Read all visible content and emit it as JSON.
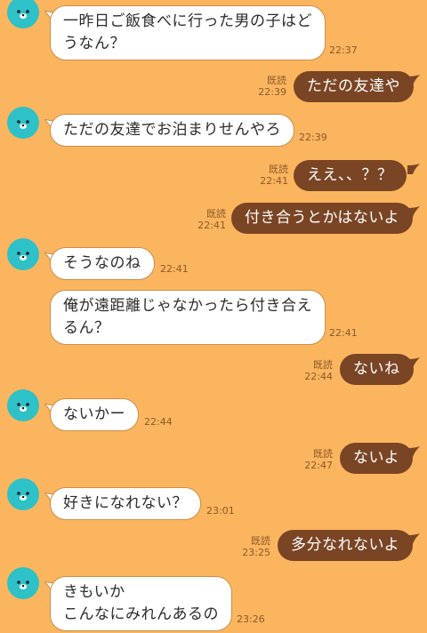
{
  "colors": {
    "background": "#fbb55e",
    "incoming_bubble": "#ffffff",
    "outgoing_bubble": "#7a4524",
    "avatar": "#2ec1c7",
    "meta_text": "#8a5a2a"
  },
  "read_label": "既読",
  "messages": [
    {
      "side": "in",
      "lines": [
        "一昨日ご飯食べに行った男の子はど",
        "うなん？"
      ],
      "time": "22:37"
    },
    {
      "side": "out",
      "lines": [
        "ただの友達や"
      ],
      "time": "22:39",
      "read": true
    },
    {
      "side": "in",
      "lines": [
        "ただの友達でお泊まりせんやろ"
      ],
      "time": "22:39"
    },
    {
      "side": "out",
      "lines": [
        "ええ、、？？"
      ],
      "time": "22:41",
      "read": true
    },
    {
      "side": "out",
      "lines": [
        "付き合うとかはないよ"
      ],
      "time": "22:41",
      "read": true
    },
    {
      "side": "in",
      "lines": [
        "そうなのね"
      ],
      "time": "22:41"
    },
    {
      "side": "in",
      "lines": [
        "俺が遠距離じゃなかったら付き合え",
        "るん？"
      ],
      "time": "22:41"
    },
    {
      "side": "out",
      "lines": [
        "ないね"
      ],
      "time": "22:44",
      "read": true
    },
    {
      "side": "in",
      "lines": [
        "ないかー"
      ],
      "time": "22:44"
    },
    {
      "side": "out",
      "lines": [
        "ないよ"
      ],
      "time": "22:47",
      "read": true
    },
    {
      "side": "in",
      "lines": [
        "好きになれない？"
      ],
      "time": "23:01"
    },
    {
      "side": "out",
      "lines": [
        "多分なれないよ"
      ],
      "time": "23:25",
      "read": true
    },
    {
      "side": "in",
      "lines": [
        "きもいか",
        "こんなにみれんあるの"
      ],
      "time": "23:26"
    }
  ]
}
